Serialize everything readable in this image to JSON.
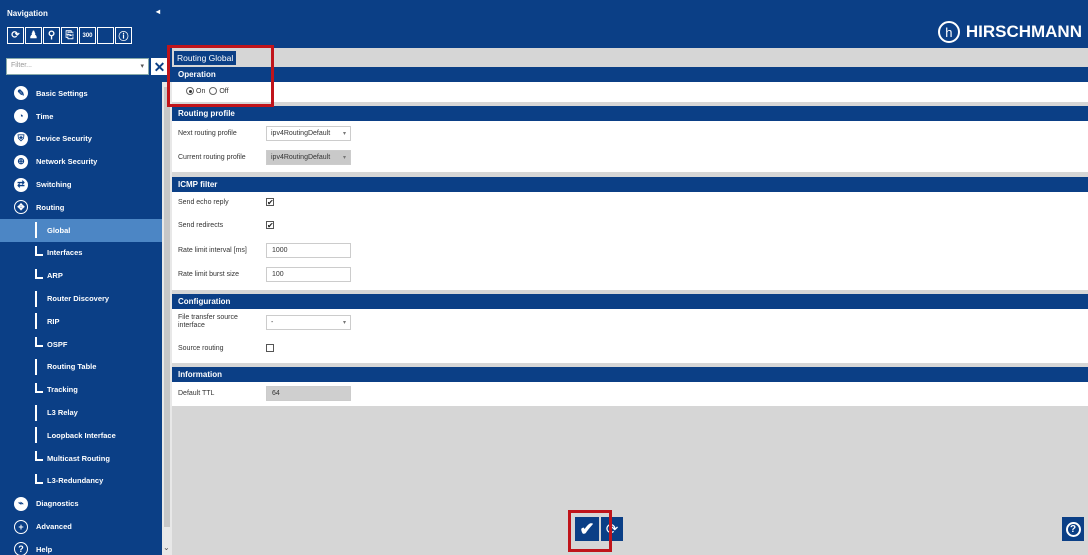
{
  "sidebar": {
    "title": "Navigation",
    "collapse_glyph": "◂",
    "toolbar": [
      {
        "name": "refresh-icon",
        "glyph": "⟳"
      },
      {
        "name": "user-icon",
        "glyph": "♟"
      },
      {
        "name": "search-refresh-icon",
        "glyph": "⚲"
      },
      {
        "name": "export-icon",
        "glyph": "⎘"
      },
      {
        "name": "counter-icon",
        "glyph": "300"
      },
      {
        "name": "blank-icon",
        "glyph": ""
      },
      {
        "name": "info-icon",
        "glyph": "ⓘ"
      }
    ],
    "filter_placeholder": "Filter...",
    "items": [
      {
        "label": "Basic Settings",
        "icon": "wrench-icon",
        "glyph": "✎"
      },
      {
        "label": "Time",
        "icon": "clock-icon",
        "glyph": "◔"
      },
      {
        "label": "Device Security",
        "icon": "shield-icon",
        "glyph": "⛨"
      },
      {
        "label": "Network Security",
        "icon": "globe-lock-icon",
        "glyph": "⊕"
      },
      {
        "label": "Switching",
        "icon": "switching-icon",
        "glyph": "⇄"
      },
      {
        "label": "Routing",
        "icon": "routing-icon",
        "glyph": "✥"
      },
      {
        "label": "Global",
        "sub": true,
        "style": "bar",
        "active": true
      },
      {
        "label": "Interfaces",
        "sub": true,
        "style": "ell"
      },
      {
        "label": "ARP",
        "sub": true,
        "style": "ell"
      },
      {
        "label": "Router Discovery",
        "sub": true,
        "style": "bar"
      },
      {
        "label": "RIP",
        "sub": true,
        "style": "bar"
      },
      {
        "label": "OSPF",
        "sub": true,
        "style": "ell"
      },
      {
        "label": "Routing Table",
        "sub": true,
        "style": "bar"
      },
      {
        "label": "Tracking",
        "sub": true,
        "style": "ell"
      },
      {
        "label": "L3 Relay",
        "sub": true,
        "style": "bar"
      },
      {
        "label": "Loopback Interface",
        "sub": true,
        "style": "bar"
      },
      {
        "label": "Multicast Routing",
        "sub": true,
        "style": "ell"
      },
      {
        "label": "L3-Redundancy",
        "sub": true,
        "style": "ell"
      },
      {
        "label": "Diagnostics",
        "icon": "diagnostics-icon",
        "glyph": "⌁"
      },
      {
        "label": "Advanced",
        "icon": "plus-circle-icon",
        "glyph": "+"
      },
      {
        "label": "Help",
        "icon": "help-circle-icon",
        "glyph": "?"
      }
    ]
  },
  "header": {
    "brand": "HIRSCHMANN",
    "logo_glyph": "h"
  },
  "page": {
    "title": "Routing Global",
    "operation": {
      "header": "Operation",
      "on_label": "On",
      "off_label": "Off",
      "selected": "On"
    },
    "routing_profile": {
      "header": "Routing profile",
      "next_label": "Next routing profile",
      "next_value": "ipv4RoutingDefault",
      "current_label": "Current routing profile",
      "current_value": "ipv4RoutingDefault"
    },
    "icmp": {
      "header": "ICMP filter",
      "echo_label": "Send echo reply",
      "echo_checked": "✔",
      "redirects_label": "Send redirects",
      "redirects_checked": "✔",
      "rate_interval_label": "Rate limit interval [ms]",
      "rate_interval_value": "1000",
      "burst_label": "Rate limit burst size",
      "burst_value": "100"
    },
    "configuration": {
      "header": "Configuration",
      "file_transfer_label": "File transfer source interface",
      "file_transfer_value": "-",
      "source_routing_label": "Source routing"
    },
    "information": {
      "header": "Information",
      "ttl_label": "Default TTL",
      "ttl_value": "64"
    }
  },
  "footer": {
    "apply_glyph": "✔",
    "reload_glyph": "⟳",
    "help_glyph": "?"
  },
  "colors": {
    "primary": "#0b3f86",
    "active": "#4c86c5",
    "annotation": "#c0141b"
  }
}
